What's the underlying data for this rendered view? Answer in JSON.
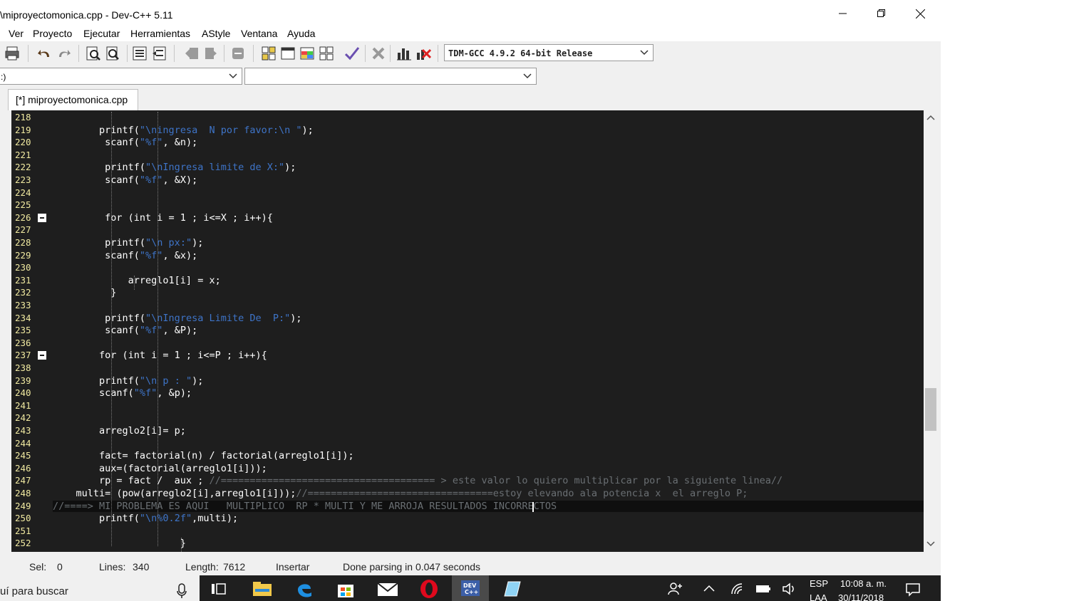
{
  "window": {
    "title": "\\miproyectomonica.cpp - Dev-C++ 5.11"
  },
  "menu": [
    "Ver",
    "Proyecto",
    "Ejecutar",
    "Herramientas",
    "AStyle",
    "Ventana",
    "Ayuda"
  ],
  "toolbar": {
    "compiler": "TDM-GCC 4.9.2 64-bit Release"
  },
  "selectors": {
    "left_value": ":)",
    "right_value": ""
  },
  "tab": {
    "label": "[*] miproyectomonica.cpp"
  },
  "editor": {
    "lines": [
      {
        "n": "218",
        "code": ""
      },
      {
        "n": "219",
        "code": "        printf(\"\\ningresa  N por favor:\\n \");"
      },
      {
        "n": "220",
        "code": "         scanf(\"%f\", &n);"
      },
      {
        "n": "221",
        "code": ""
      },
      {
        "n": "222",
        "code": "         printf(\"\\nIngresa limite de X:\");"
      },
      {
        "n": "223",
        "code": "         scanf(\"%f\", &X);"
      },
      {
        "n": "224",
        "code": ""
      },
      {
        "n": "225",
        "code": ""
      },
      {
        "n": "226",
        "code": "         for (int i = 1 ; i<=X ; i++){"
      },
      {
        "n": "227",
        "code": ""
      },
      {
        "n": "228",
        "code": "         printf(\"\\n px:\");"
      },
      {
        "n": "229",
        "code": "         scanf(\"%f\", &x);"
      },
      {
        "n": "230",
        "code": ""
      },
      {
        "n": "231",
        "code": "             arreglo1[i] = x;"
      },
      {
        "n": "232",
        "code": "          }"
      },
      {
        "n": "233",
        "code": ""
      },
      {
        "n": "234",
        "code": "         printf(\"\\nIngresa Limite De  P:\");"
      },
      {
        "n": "235",
        "code": "         scanf(\"%f\", &P);"
      },
      {
        "n": "236",
        "code": ""
      },
      {
        "n": "237",
        "code": "        for (int i = 1 ; i<=P ; i++){"
      },
      {
        "n": "238",
        "code": ""
      },
      {
        "n": "239",
        "code": "        printf(\"\\n p : \");"
      },
      {
        "n": "240",
        "code": "        scanf(\"%f\", &p);"
      },
      {
        "n": "241",
        "code": ""
      },
      {
        "n": "242",
        "code": ""
      },
      {
        "n": "243",
        "code": "        arreglo2[i]= p;"
      },
      {
        "n": "244",
        "code": ""
      },
      {
        "n": "245",
        "code": "        fact= factorial(n) / factorial(arreglo1[i]);"
      },
      {
        "n": "246",
        "code": "        aux=(factorial(arreglo1[i]));"
      },
      {
        "n": "247",
        "code": "        rp = fact /  aux ; //===================================== > este valor lo quiero multiplicar por la siguiente linea//"
      },
      {
        "n": "248",
        "code": "    multi= (pow(arreglo2[i],arreglo1[i]));//================================estoy elevando ala potencia x  el arreglo P;"
      },
      {
        "n": "249",
        "code": "//====> MI PROBLEMA ES AQUI   MULTIPLICO  RP * MULTI Y ME ARROJA RESULTADOS INCORRECTOS"
      },
      {
        "n": "250",
        "code": "        printf(\"\\n%0.2f\",multi);"
      },
      {
        "n": "251",
        "code": ""
      },
      {
        "n": "252",
        "code": "                      }"
      }
    ]
  },
  "status": {
    "sel_label": "Sel:",
    "sel_value": "0",
    "lines_label": "Lines:",
    "lines_value": "340",
    "length_label": "Length:",
    "length_value": "7612",
    "mode": "Insertar",
    "message": "Done parsing in 0.047 seconds"
  },
  "taskbar": {
    "search_placeholder": "uí para buscar",
    "lang_top": "ESP",
    "lang_bottom": "LAA",
    "time": "10:08 a. m.",
    "date": "30/11/2018"
  }
}
